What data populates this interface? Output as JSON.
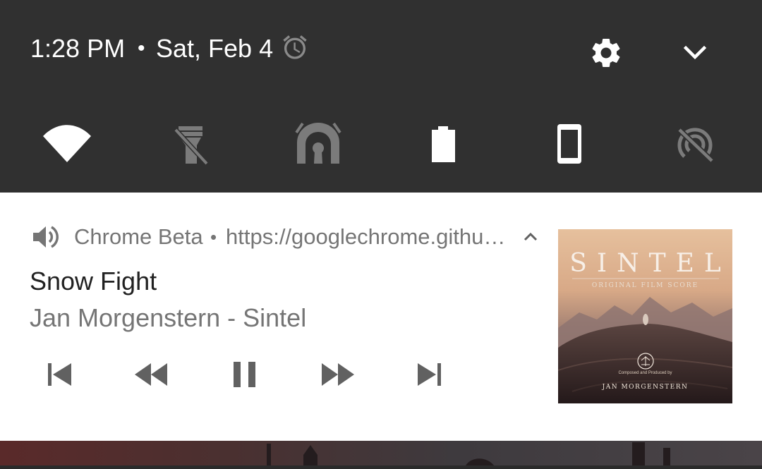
{
  "status_bar": {
    "time": "1:28 PM",
    "separator": "•",
    "date": "Sat, Feb 4",
    "icons": [
      "alarm-icon",
      "settings-gear-icon",
      "expand-chevron-down-icon"
    ]
  },
  "quick_settings": {
    "tiles": [
      {
        "name": "wifi",
        "icon": "wifi-icon",
        "state": "on"
      },
      {
        "name": "flashlight",
        "icon": "flashlight-off-icon",
        "state": "off"
      },
      {
        "name": "cast",
        "icon": "cast-icon",
        "state": "off"
      },
      {
        "name": "battery",
        "icon": "battery-icon",
        "state": "on"
      },
      {
        "name": "auto-rotate",
        "icon": "phone-portrait-icon",
        "state": "on"
      },
      {
        "name": "hotspot",
        "icon": "hotspot-off-icon",
        "state": "off"
      }
    ]
  },
  "notification": {
    "app_name": "Chrome Beta",
    "separator": "•",
    "url": "https://googlechrome.githu…",
    "title": "Snow Fight",
    "subtitle": "Jan Morgenstern - Sintel",
    "controls": [
      "skip-previous-icon",
      "rewind-icon",
      "pause-icon",
      "fast-forward-icon",
      "skip-next-icon"
    ],
    "album_art": {
      "title": "SINTEL",
      "subtitle": "ORIGINAL FILM SCORE",
      "credit": "Composed and Produced by",
      "composer": "JAN MORGENSTERN"
    }
  },
  "colors": {
    "shade_background": "#303030",
    "icon_active": "#ffffff",
    "icon_inactive": "#7b7b7b",
    "notification_background": "#ffffff",
    "secondary_text": "#757575",
    "primary_text": "#212121"
  }
}
